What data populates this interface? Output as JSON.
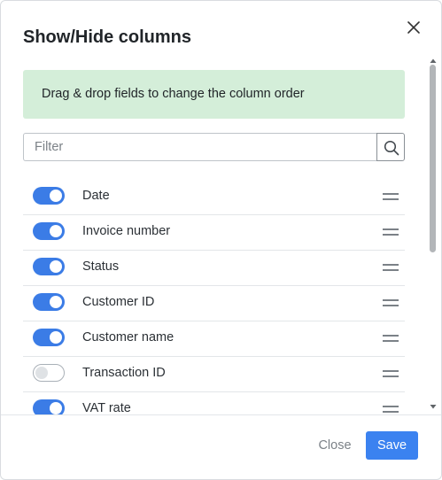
{
  "dialog": {
    "title": "Show/Hide columns",
    "close_icon": "close-icon"
  },
  "info": {
    "text": "Drag & drop fields to change the column order",
    "background": "#d4eed9"
  },
  "filter": {
    "placeholder": "Filter",
    "value": "",
    "button_icon": "search-icon"
  },
  "columns": [
    {
      "label": "Date",
      "enabled": true
    },
    {
      "label": "Invoice number",
      "enabled": true
    },
    {
      "label": "Status",
      "enabled": true
    },
    {
      "label": "Customer ID",
      "enabled": true
    },
    {
      "label": "Customer name",
      "enabled": true
    },
    {
      "label": "Transaction ID",
      "enabled": false
    },
    {
      "label": "VAT rate",
      "enabled": true
    }
  ],
  "row_icons": {
    "toggle": "toggle-switch",
    "drag": "drag-handle-icon"
  },
  "footer": {
    "close_label": "Close",
    "save_label": "Save"
  },
  "colors": {
    "accent": "#3b82f0",
    "toggle_on": "#3b7ce6",
    "muted_text": "#7b8187"
  }
}
